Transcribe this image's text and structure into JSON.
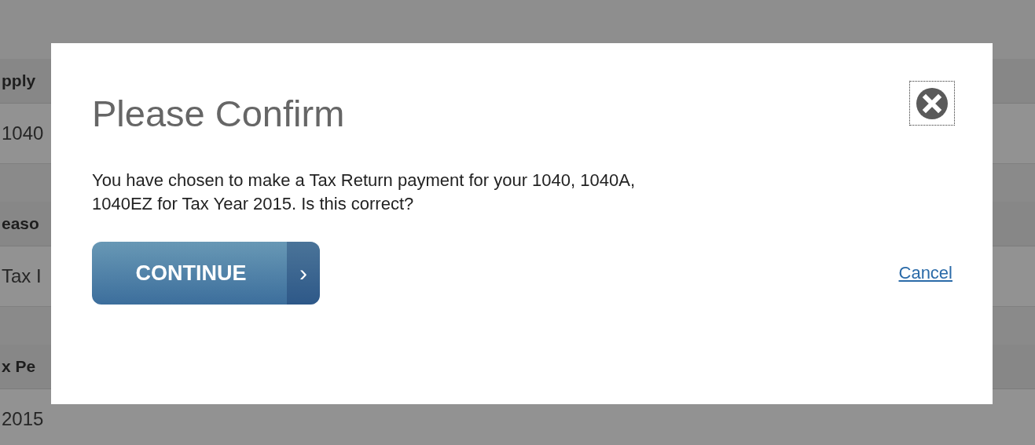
{
  "background_sections": [
    {
      "heading": "pply",
      "value": "1040"
    },
    {
      "heading": "easo",
      "value": "Tax I"
    },
    {
      "heading": "x Pe",
      "value": "2015"
    }
  ],
  "dialog": {
    "title": "Please Confirm",
    "message": "You have chosen to make a Tax Return payment for your 1040, 1040A, 1040EZ for Tax Year 2015. Is this correct?",
    "close_focused": true,
    "continue_button": {
      "label": "CONTINUE",
      "arrow": "›"
    },
    "cancel_link": "Cancel"
  }
}
